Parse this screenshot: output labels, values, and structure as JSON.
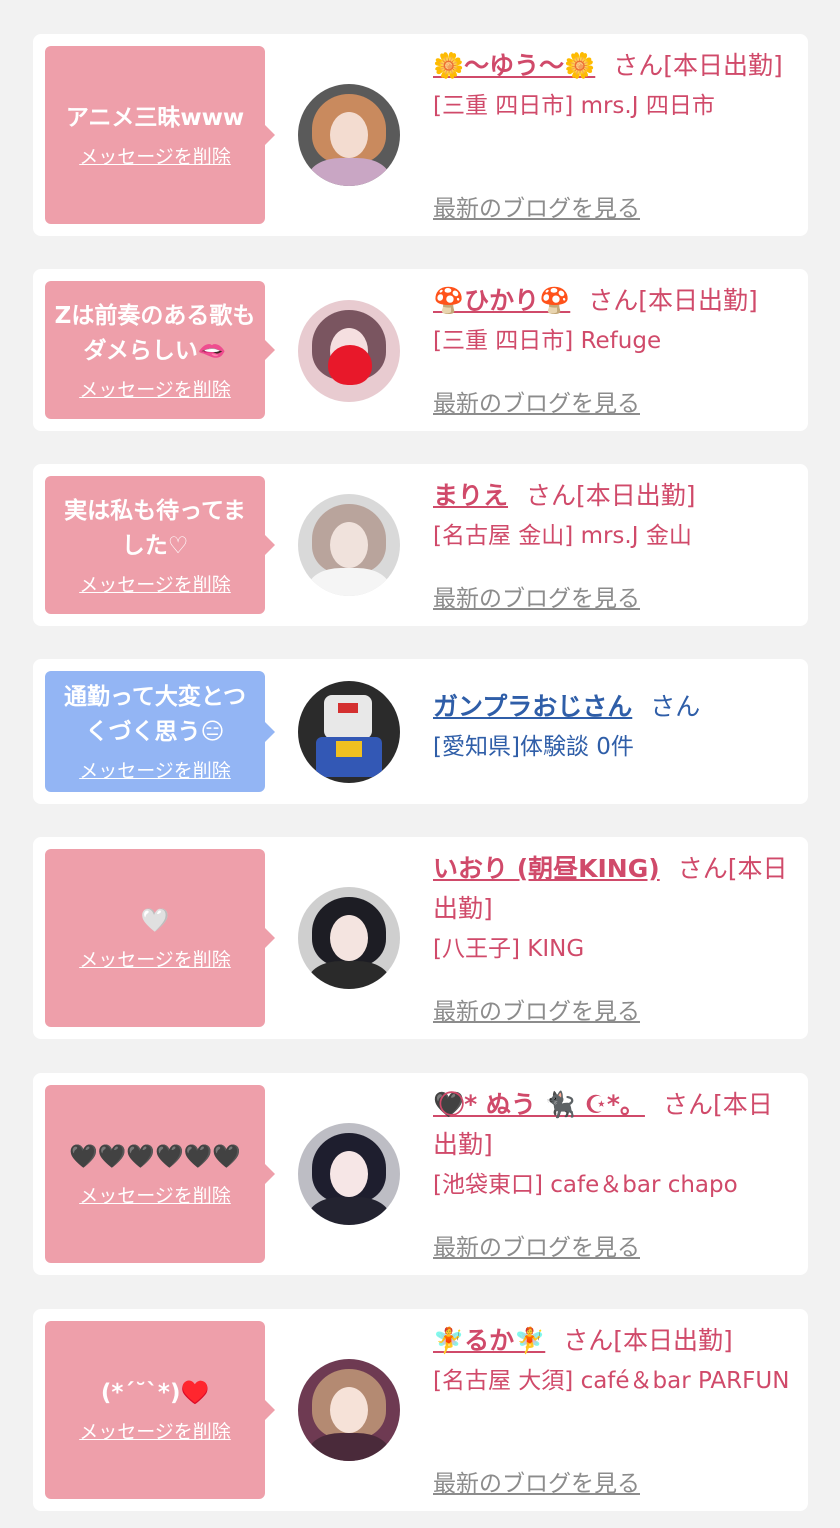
{
  "entries": [
    {
      "message": "アニメ三昧www",
      "delete_label": "メッセージを削除",
      "name": "🌼〜ゆう〜🌼",
      "suffix": "さん[本日出勤]",
      "shop": "[三重 四日市] mrs.J 四日市",
      "blog_label": "最新のブログを見る",
      "bubble_color": "#ee9faa"
    },
    {
      "message": "Zは前奏のある歌もダメらしい🫦",
      "delete_label": "メッセージを削除",
      "name": "🍄ひかり🍄",
      "suffix": "さん[本日出勤]",
      "shop": "[三重 四日市] Refuge",
      "blog_label": "最新のブログを見る",
      "bubble_color": "#ee9faa"
    },
    {
      "message": "実は私も待ってました♡",
      "delete_label": "メッセージを削除",
      "name": "まりえ",
      "suffix": "さん[本日出勤]",
      "shop": "[名古屋 金山] mrs.J 金山",
      "blog_label": "最新のブログを見る",
      "bubble_color": "#ee9faa"
    },
    {
      "message": "通勤って大変とつくづく思う😑",
      "delete_label": "メッセージを削除",
      "name": "ガンプラおじさん",
      "suffix": "さん",
      "shop": "[愛知県]体験談 0件",
      "blog_label": "",
      "bubble_color": "#93b5f4"
    },
    {
      "message": "🤍",
      "delete_label": "メッセージを削除",
      "name": "いおり (朝昼KING)",
      "suffix": "さん[本日出勤]",
      "shop": "[八王子] KING",
      "blog_label": "最新のブログを見る",
      "bubble_color": "#ee9faa"
    },
    {
      "message": "🖤🖤🖤🖤🖤🖤",
      "delete_label": "メッセージを削除",
      "name": "🖤⃝* ぬう 🐈‍⬛ ☪︎*。",
      "suffix": "さん[本日出勤]",
      "shop": "[池袋東口] cafe＆bar chapo",
      "blog_label": "最新のブログを見る",
      "bubble_color": "#ee9faa"
    },
    {
      "message": "(*´˘`*)♥️",
      "delete_label": "メッセージを削除",
      "name": "🧚るか🧚",
      "suffix": "さん[本日出勤]",
      "shop": "[名古屋 大須] café＆bar PARFUN",
      "blog_label": "最新のブログを見る",
      "bubble_color": "#ee9faa"
    }
  ]
}
